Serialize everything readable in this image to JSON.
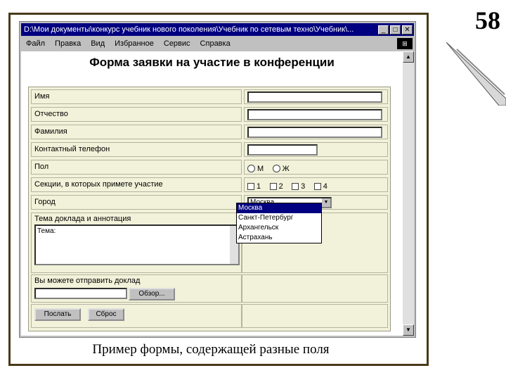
{
  "slide": {
    "page_number": "58",
    "caption": "Пример формы, содержащей разные поля"
  },
  "window": {
    "title": "D:\\Мои документы\\конкурс учебник нового поколения\\Учебник по сетевым техно\\Учебник\\...",
    "controls": {
      "minimize": "_",
      "maximize": "□",
      "close": "✕"
    },
    "menu": [
      "Файл",
      "Правка",
      "Вид",
      "Избранное",
      "Сервис",
      "Справка"
    ]
  },
  "form": {
    "title": "Форма заявки на участие в конференции",
    "fields": {
      "name_label": "Имя",
      "patronymic_label": "Отчество",
      "surname_label": "Фамилия",
      "phone_label": "Контактный телефон",
      "gender_label": "Пол",
      "gender_options": [
        "М",
        "Ж"
      ],
      "sections_label": "Секции, в которых примете участие",
      "section_options": [
        "1",
        "2",
        "3",
        "4"
      ],
      "city_label": "Город",
      "city_selected": "Москва",
      "city_options": [
        "Москва",
        "Санкт-Петербург",
        "Архангельск",
        "Астрахань"
      ],
      "topic_label": "Тема доклада и аннотация",
      "topic_value": "Тема:",
      "upload_label": "Вы можете отправить доклад",
      "browse_button": "Обзор...",
      "submit_button": "Послать",
      "reset_button": "Сброс"
    }
  }
}
